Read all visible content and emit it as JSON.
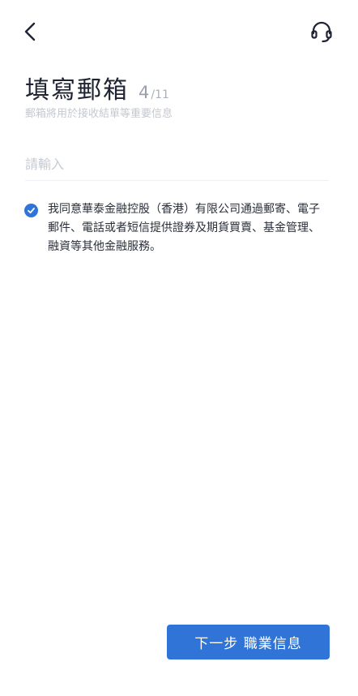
{
  "header": {
    "back_icon": "chevron-left-icon",
    "support_icon": "headset-icon"
  },
  "main": {
    "title": "填寫郵箱",
    "step_current": "4",
    "step_total": "/11",
    "subtitle": "郵箱將用於接收結單等重要信息",
    "email_input": {
      "value": "",
      "placeholder": "請輸入"
    },
    "consent": {
      "checked": true,
      "text": "我同意華泰金融控股（香港）有限公司通過郵寄、電子郵件、電話或者短信提供證券及期貨買賣、基金管理、融資等其他金融服務。"
    }
  },
  "footer": {
    "next_button_label": "下一步 職業信息"
  },
  "colors": {
    "accent": "#2f74d6",
    "title_text": "#1f2433",
    "muted_text": "#c4c8cf"
  }
}
